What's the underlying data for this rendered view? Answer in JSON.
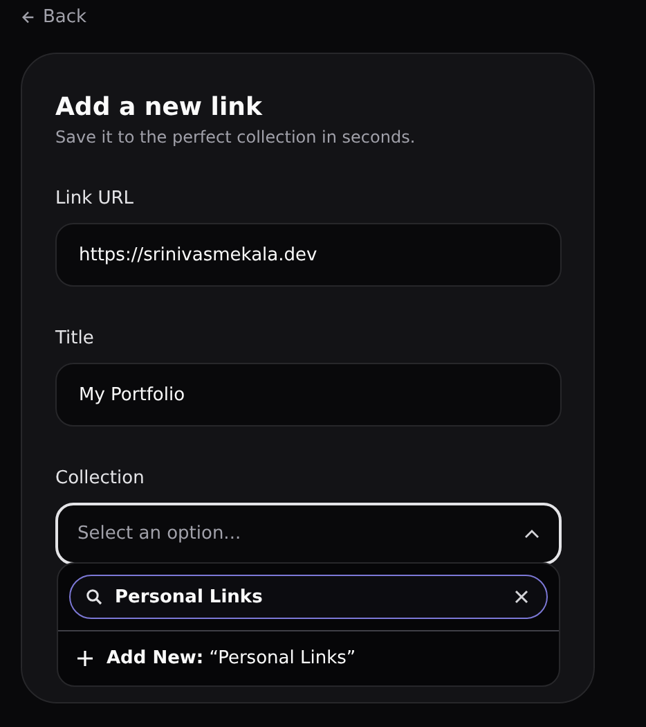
{
  "back_link": {
    "label": "Back"
  },
  "form": {
    "title": "Add a new link",
    "subtitle": "Save it to the perfect collection in seconds.",
    "fields": [
      {
        "label": "Link URL",
        "value": "https://srinivasmekala.dev"
      },
      {
        "label": "Title",
        "value": "My Portfolio"
      }
    ],
    "collection": {
      "label": "Collection",
      "placeholder": "Select an option...",
      "expanded": true,
      "search": {
        "value": "Personal Links"
      },
      "options": [
        {
          "kind": "add",
          "label": "**Add New:** “Personal Links”"
        }
      ]
    }
  }
}
